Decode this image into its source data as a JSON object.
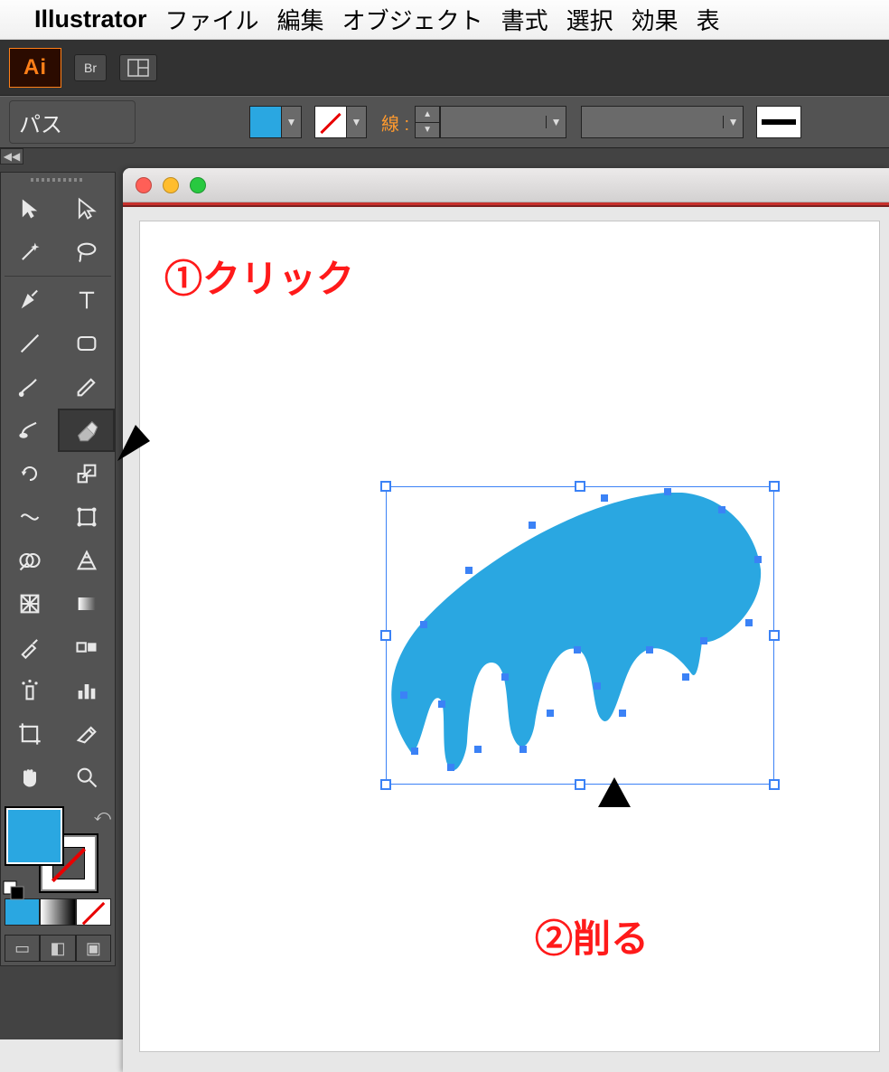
{
  "menubar": {
    "apple": "",
    "app_name": "Illustrator",
    "items": [
      "ファイル",
      "編集",
      "オブジェクト",
      "書式",
      "選択",
      "効果",
      "表"
    ]
  },
  "app_top": {
    "ai_label": "Ai",
    "br_label": "Br",
    "layout_label": "▦"
  },
  "control_bar": {
    "left_label": "パス",
    "stroke_label": "線 :",
    "stroke_weight": "",
    "stroke_profile": ""
  },
  "tools": {
    "items": [
      {
        "name": "selection-tool",
        "icon": "cursor-black"
      },
      {
        "name": "direct-selection-tool",
        "icon": "cursor-white"
      },
      {
        "name": "magic-wand-tool",
        "icon": "wand"
      },
      {
        "name": "lasso-tool",
        "icon": "lasso"
      },
      {
        "name": "pen-tool",
        "icon": "pen"
      },
      {
        "name": "type-tool",
        "icon": "type"
      },
      {
        "name": "line-segment-tool",
        "icon": "line"
      },
      {
        "name": "rectangle-tool",
        "icon": "rect"
      },
      {
        "name": "paintbrush-tool",
        "icon": "brush"
      },
      {
        "name": "pencil-tool",
        "icon": "pencil"
      },
      {
        "name": "blob-brush-tool",
        "icon": "blob"
      },
      {
        "name": "eraser-tool",
        "icon": "eraser",
        "selected": true
      },
      {
        "name": "rotate-tool",
        "icon": "rotate"
      },
      {
        "name": "scale-tool",
        "icon": "scale"
      },
      {
        "name": "width-tool",
        "icon": "width"
      },
      {
        "name": "free-transform-tool",
        "icon": "freetransform"
      },
      {
        "name": "shape-builder-tool",
        "icon": "shapebuilder"
      },
      {
        "name": "perspective-grid-tool",
        "icon": "perspective"
      },
      {
        "name": "mesh-tool",
        "icon": "mesh"
      },
      {
        "name": "gradient-tool",
        "icon": "gradient"
      },
      {
        "name": "eyedropper-tool",
        "icon": "eyedropper"
      },
      {
        "name": "blend-tool",
        "icon": "blend"
      },
      {
        "name": "symbol-sprayer-tool",
        "icon": "sprayer"
      },
      {
        "name": "column-graph-tool",
        "icon": "graph"
      },
      {
        "name": "artboard-tool",
        "icon": "artboard"
      },
      {
        "name": "slice-tool",
        "icon": "slice"
      },
      {
        "name": "hand-tool",
        "icon": "hand"
      },
      {
        "name": "zoom-tool",
        "icon": "zoom"
      }
    ]
  },
  "colors": {
    "fill": "#2aa7e1",
    "stroke": "none"
  },
  "annotations": {
    "step1": "①クリック",
    "step2": "②削る"
  }
}
